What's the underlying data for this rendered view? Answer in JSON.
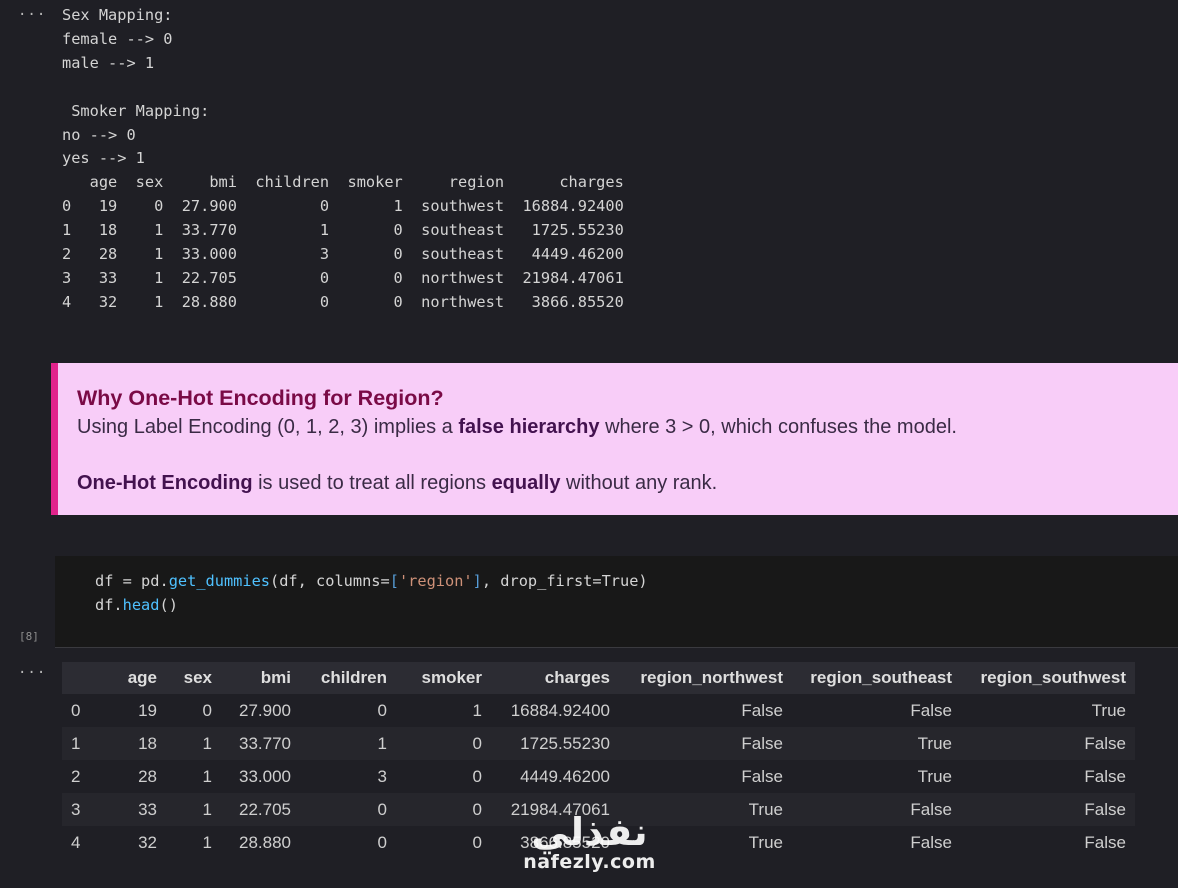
{
  "output1": {
    "lines": [
      "Sex Mapping:",
      "female --> 0",
      "male --> 1",
      "",
      " Smoker Mapping:",
      "no --> 0",
      "yes --> 1",
      "   age  sex     bmi  children  smoker     region      charges",
      "0   19    0  27.900         0       1  southwest  16884.92400",
      "1   18    1  33.770         1       0  southeast   1725.55230",
      "2   28    1  33.000         3       0  southeast   4449.46200",
      "3   33    1  22.705         0       0  northwest  21984.47061",
      "4   32    1  28.880         0       0  northwest   3866.85520"
    ]
  },
  "markdown": {
    "heading": "Why One-Hot Encoding for Region?",
    "p1_a": "Using Label Encoding (0, 1, 2, 3) implies a ",
    "p1_b": "false hierarchy",
    "p1_c": " where 3 > 0, which confuses the model.",
    "p2_a": "One-Hot Encoding",
    "p2_b": " is used to treat all regions ",
    "p2_c": "equally",
    "p2_d": " without any rank."
  },
  "code": {
    "l1_a": "df = pd.",
    "l1_fn": "get_dummies",
    "l1_b": "(df, columns=",
    "l1_br1": "[",
    "l1_str": "'region'",
    "l1_br2": "]",
    "l1_c": ", drop_first=True)",
    "l2_a": "df.",
    "l2_fn": "head",
    "l2_b": "()"
  },
  "cell_number": "[8]",
  "ellipsis": "···",
  "table": {
    "columns": [
      "",
      "age",
      "sex",
      "bmi",
      "children",
      "smoker",
      "charges",
      "region_northwest",
      "region_southeast",
      "region_southwest"
    ],
    "rows": [
      [
        "0",
        "19",
        "0",
        "27.900",
        "0",
        "1",
        "16884.92400",
        "False",
        "False",
        "True"
      ],
      [
        "1",
        "18",
        "1",
        "33.770",
        "1",
        "0",
        "1725.55230",
        "False",
        "True",
        "False"
      ],
      [
        "2",
        "28",
        "1",
        "33.000",
        "3",
        "0",
        "4449.46200",
        "False",
        "True",
        "False"
      ],
      [
        "3",
        "33",
        "1",
        "22.705",
        "0",
        "0",
        "21984.47061",
        "True",
        "False",
        "False"
      ],
      [
        "4",
        "32",
        "1",
        "28.880",
        "0",
        "0",
        "3866.85520",
        "True",
        "False",
        "False"
      ]
    ]
  },
  "watermark": {
    "arabic": "نفذلي",
    "latin": "nafezly.com"
  }
}
